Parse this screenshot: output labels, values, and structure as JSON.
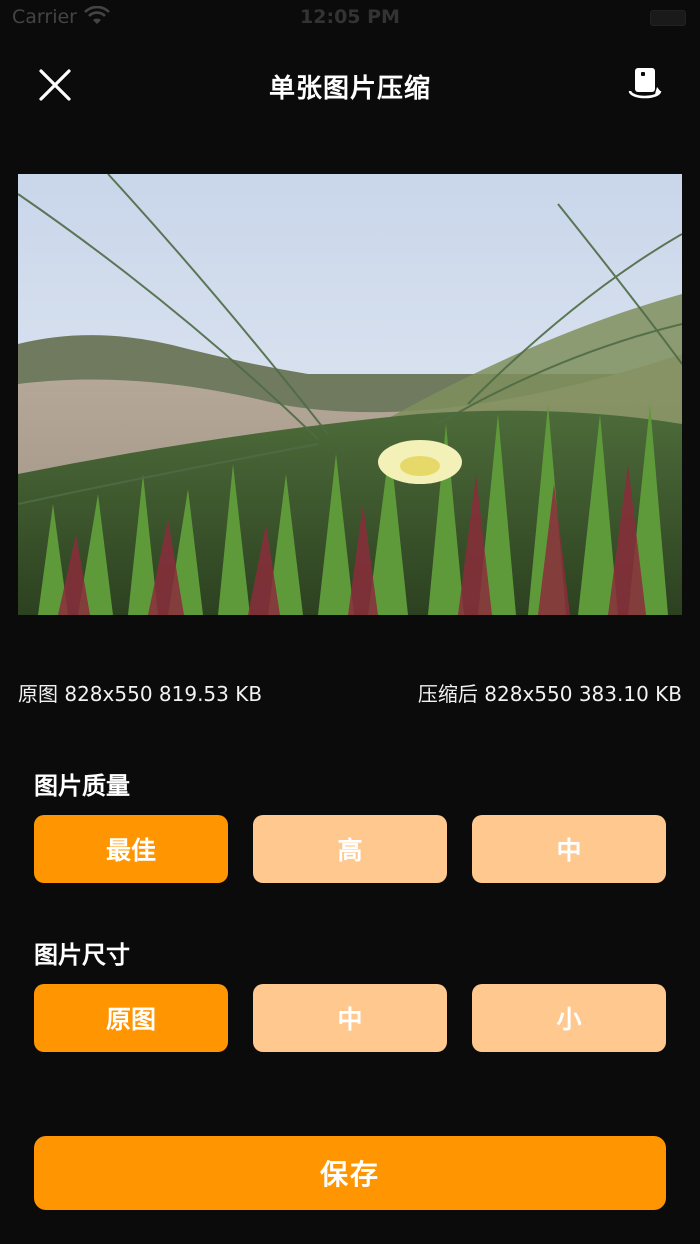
{
  "status_bar": {
    "carrier": "Carrier",
    "time": "12:05 PM"
  },
  "header": {
    "title": "单张图片压缩"
  },
  "info": {
    "original": "原图 828x550 819.53 KB",
    "compressed": "压缩后 828x550 383.10 KB"
  },
  "quality": {
    "label": "图片质量",
    "options": [
      "最佳",
      "高",
      "中"
    ],
    "selected_index": 0
  },
  "size": {
    "label": "图片尺寸",
    "options": [
      "原图",
      "中",
      "小"
    ],
    "selected_index": 0
  },
  "save_label": "保存",
  "colors": {
    "accent": "#ff9500",
    "accent_light": "#ffc88f",
    "background": "#0b0b0b"
  }
}
